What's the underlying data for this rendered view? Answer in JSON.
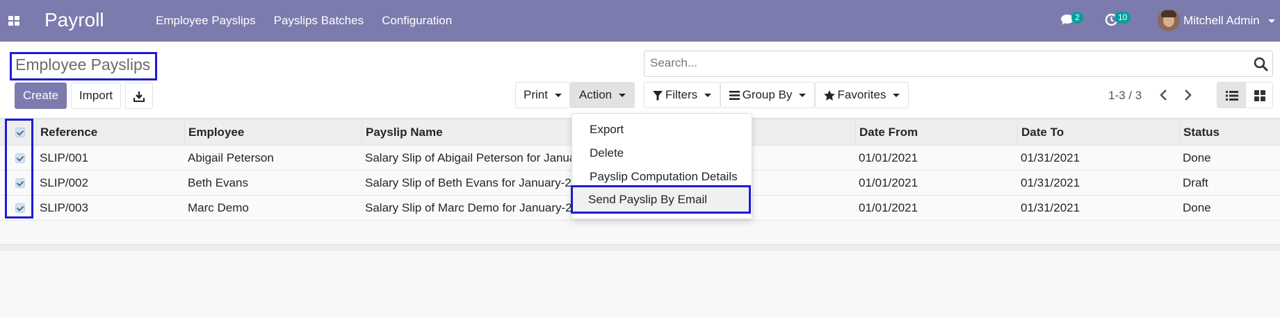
{
  "navbar": {
    "app_title": "Payroll",
    "menu": [
      "Employee Payslips",
      "Payslips Batches",
      "Configuration"
    ],
    "chat_badge": "2",
    "activity_badge": "10",
    "user_name": "Mitchell Admin"
  },
  "control_panel": {
    "page_title": "Employee Payslips",
    "search_placeholder": "Search...",
    "create_label": "Create",
    "import_label": "Import",
    "print_label": "Print",
    "action_label": "Action",
    "filters_label": "Filters",
    "groupby_label": "Group By",
    "favorites_label": "Favorites",
    "pager": "1-3 / 3"
  },
  "action_menu": {
    "items": [
      "Export",
      "Delete",
      "Payslip Computation Details",
      "Send Payslip By Email"
    ],
    "highlighted_index": 3
  },
  "table": {
    "columns": [
      "Reference",
      "Employee",
      "Payslip Name",
      "Date From",
      "Date To",
      "Status"
    ],
    "rows": [
      {
        "reference": "SLIP/001",
        "employee": "Abigail Peterson",
        "payslip_name": "Salary Slip of Abigail Peterson for January-2021",
        "date_from": "01/01/2021",
        "date_to": "01/31/2021",
        "status": "Done",
        "selected": true
      },
      {
        "reference": "SLIP/002",
        "employee": "Beth Evans",
        "payslip_name": "Salary Slip of Beth Evans for January-2021",
        "date_from": "01/01/2021",
        "date_to": "01/31/2021",
        "status": "Draft",
        "selected": true
      },
      {
        "reference": "SLIP/003",
        "employee": "Marc Demo",
        "payslip_name": "Salary Slip of Marc Demo for January-2021",
        "date_from": "01/01/2021",
        "date_to": "01/31/2021",
        "status": "Done",
        "selected": true
      }
    ]
  },
  "colors": {
    "navbar": "#7c7bad",
    "primary": "#7c7bad",
    "badge": "#00a09d",
    "annotation_box": "#1b1bd6"
  },
  "icons": [
    "apps-icon",
    "chat-icon",
    "activity-clock-icon",
    "search-icon",
    "download-icon",
    "filter-icon",
    "group-by-icon",
    "star-icon",
    "chevron-left-icon",
    "chevron-right-icon",
    "list-view-icon",
    "kanban-view-icon"
  ]
}
